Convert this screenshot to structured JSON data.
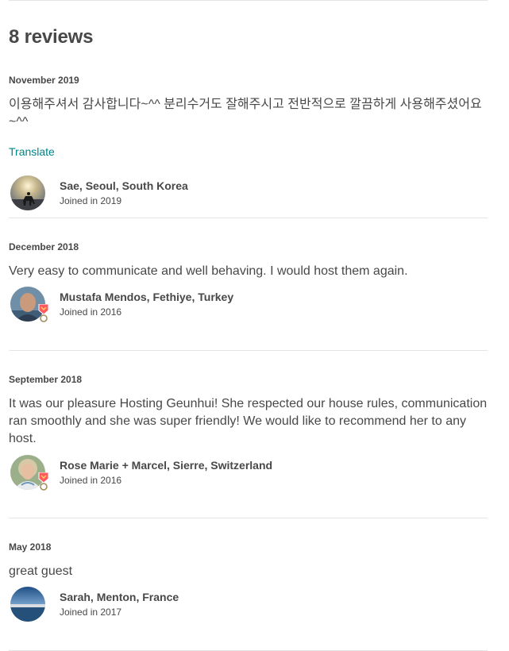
{
  "header": {
    "title": "8 reviews"
  },
  "reviews": [
    {
      "date": "November 2019",
      "text": "이용해주셔서 감사합니다~^^ 분리수거도 잘해주시고 전반적으로 깔끔하게 사용해주셨어요~^^",
      "translate_label": "Translate",
      "reviewer": {
        "name": "Sae, Seoul, South Korea",
        "joined": "Joined in 2019",
        "superhost": false
      }
    },
    {
      "date": "December 2018",
      "text": "Very easy to communicate and well behaving. I would host them again.",
      "reviewer": {
        "name": "Mustafa Mendos, Fethiye, Turkey",
        "joined": "Joined in 2016",
        "superhost": true
      }
    },
    {
      "date": "September 2018",
      "text": "It was our pleasure Hosting Geunhui! She respected our house rules, communication ran smoothly and she was super friendly! We would like to recommend her to any host.",
      "reviewer": {
        "name": "Rose Marie + Marcel, Sierre, Switzerland",
        "joined": "Joined in 2016",
        "superhost": true
      }
    },
    {
      "date": "May 2018",
      "text": "great guest",
      "reviewer": {
        "name": "Sarah, Menton, France",
        "joined": "Joined in 2017",
        "superhost": false
      }
    }
  ],
  "colors": {
    "text": "#484848",
    "link": "#008489",
    "divider": "#e4e4e4",
    "superhost_badge": "#ff5a5f"
  }
}
